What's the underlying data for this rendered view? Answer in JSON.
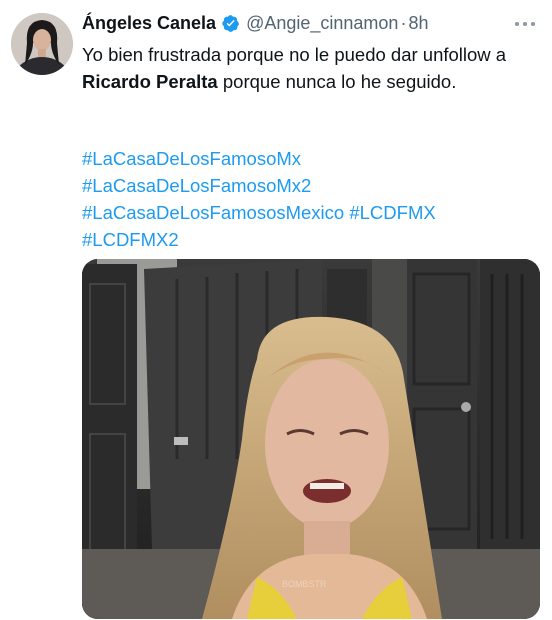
{
  "tweet": {
    "display_name": "Ángeles Canela",
    "handle": "@Angie_cinnamon",
    "separator": "·",
    "time": "8h",
    "more_icon": "more-horizontal-icon",
    "verified_icon": "verified-badge-icon",
    "text_before": "Yo bien frustrada porque no le puedo dar unfollow a ",
    "text_bold": "Ricardo Peralta",
    "text_after": " porque nunca lo he seguido.",
    "hashtags": [
      "#LaCasaDeLosFamosoMx",
      "#LaCasaDeLosFamosoMx2",
      "#LaCasaDeLosFamososMexico",
      "#LCDFMX",
      "#LCDFMX2"
    ],
    "media_watermark": "BOMBSTR"
  },
  "colors": {
    "link": "#1d9bf0",
    "secondary": "#536471",
    "verified": "#1d9bf0"
  }
}
